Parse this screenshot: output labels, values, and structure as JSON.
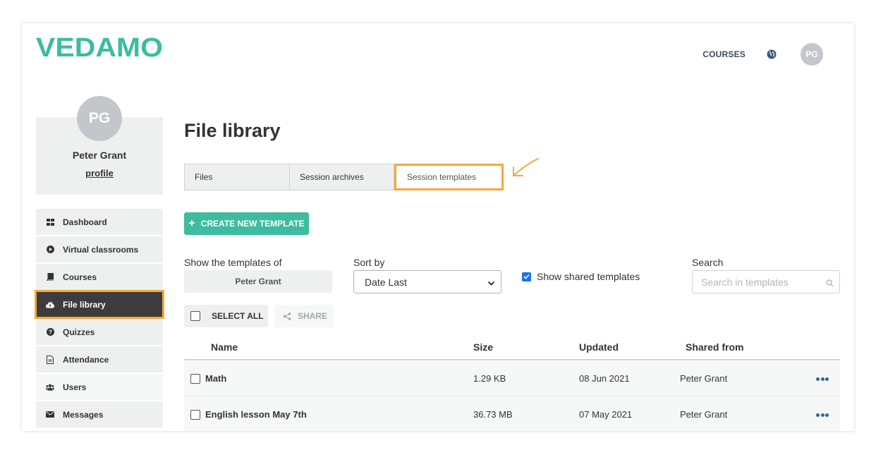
{
  "brand": {
    "logo_text": "VEDAMO",
    "logo_color": "#3dbc9f"
  },
  "header": {
    "courses_label": "COURSES",
    "avatar_initials": "PG"
  },
  "profile": {
    "initials": "PG",
    "name": "Peter Grant",
    "link_label": "profile"
  },
  "sidebar": {
    "items": [
      {
        "label": "Dashboard",
        "icon": "grid-icon"
      },
      {
        "label": "Virtual classrooms",
        "icon": "play-circle-icon"
      },
      {
        "label": "Courses",
        "icon": "book-icon"
      },
      {
        "label": "File library",
        "icon": "cloud-upload-icon",
        "active": true
      },
      {
        "label": "Quizzes",
        "icon": "question-circle-icon"
      },
      {
        "label": "Attendance",
        "icon": "document-icon"
      },
      {
        "label": "Users",
        "icon": "users-icon"
      },
      {
        "label": "Messages",
        "icon": "envelope-icon"
      }
    ]
  },
  "main": {
    "title": "File library",
    "tabs": [
      {
        "label": "Files"
      },
      {
        "label": "Session archives"
      },
      {
        "label": "Session templates",
        "active": true
      }
    ],
    "create_button": "CREATE NEW TEMPLATE",
    "filters": {
      "owner_label": "Show the templates of",
      "owner_value": "Peter Grant",
      "sort_label": "Sort by",
      "sort_value": "Date Last",
      "shared_label": "Show shared templates",
      "shared_checked": true,
      "search_label": "Search",
      "search_placeholder": "Search in templates"
    },
    "actions": {
      "select_all": "SELECT ALL",
      "share": "SHARE"
    },
    "table": {
      "columns": [
        "Name",
        "Size",
        "Updated",
        "Shared from"
      ],
      "rows": [
        {
          "name": "Math",
          "size": "1.29 KB",
          "updated": "08 Jun 2021",
          "shared_from": "Peter Grant"
        },
        {
          "name": "English lesson May 7th",
          "size": "36.73 MB",
          "updated": "07 May 2021",
          "shared_from": "Peter Grant"
        }
      ]
    }
  },
  "colors": {
    "accent": "#3dbc9f",
    "highlight": "#f4a83a",
    "active_menu": "#3c3c3c",
    "dots": "#2f64a6"
  }
}
